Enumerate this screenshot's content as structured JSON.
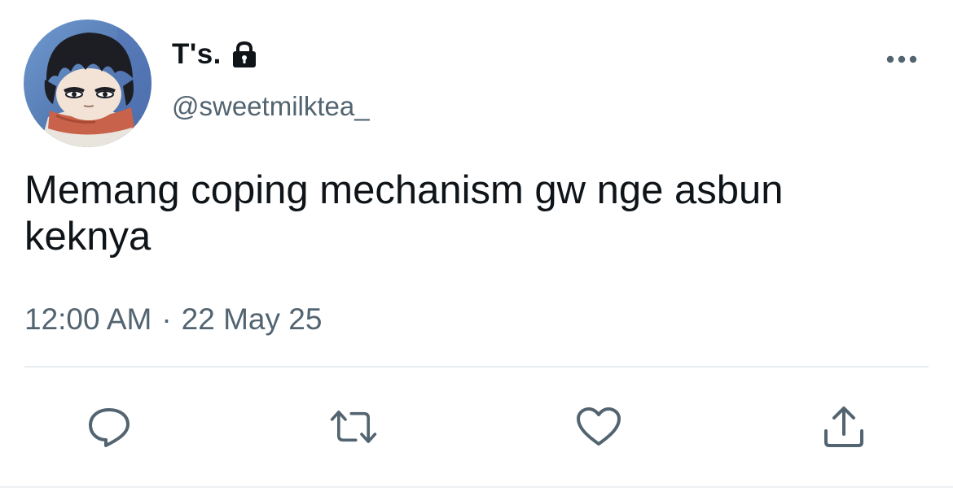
{
  "tweet": {
    "display_name": "T's.",
    "handle": "@sweetmilktea_",
    "text": "Memang coping mechanism gw nge asbun keknya",
    "time": "12:00 AM",
    "separator": "·",
    "date": "22 May 25",
    "protected": true
  },
  "icons": {
    "lock": "lock-icon",
    "more": "more-horizontal-icon",
    "reply": "reply-icon",
    "retweet": "retweet-icon",
    "like": "heart-icon",
    "share": "share-icon"
  },
  "colors": {
    "text_primary": "#0f1419",
    "text_secondary": "#536471",
    "divider": "#e6ecf0"
  }
}
